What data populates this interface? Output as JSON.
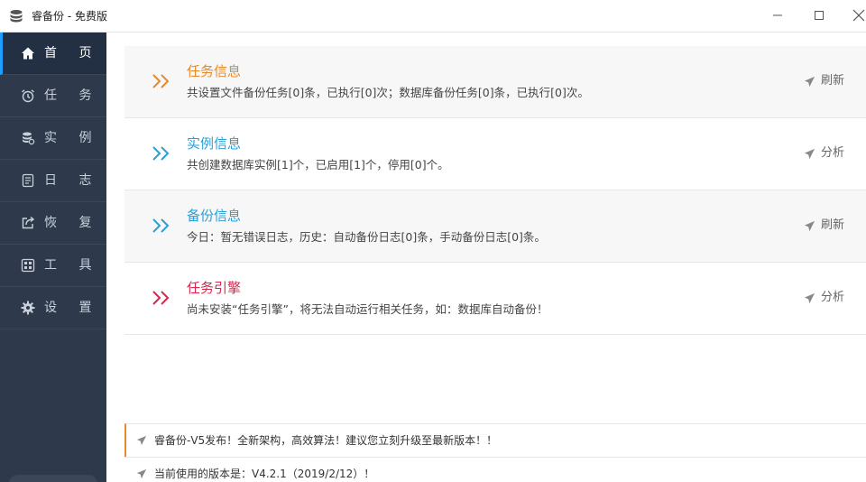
{
  "window": {
    "title": "睿备份 - 免费版",
    "controls": [
      "minimize",
      "maximize",
      "close"
    ]
  },
  "sidebar": {
    "items": [
      {
        "label": "首 页",
        "icon": "home-icon",
        "active": true
      },
      {
        "label": "任 务",
        "icon": "alarm-clock-icon",
        "active": false
      },
      {
        "label": "实 例",
        "icon": "database-icon",
        "active": false
      },
      {
        "label": "日 志",
        "icon": "log-document-icon",
        "active": false
      },
      {
        "label": "恢 复",
        "icon": "restore-share-icon",
        "active": false
      },
      {
        "label": "工 具",
        "icon": "tools-grid-icon",
        "active": false
      },
      {
        "label": "设 置",
        "icon": "gear-icon",
        "active": false
      }
    ]
  },
  "cards": [
    {
      "title": "任务信息",
      "desc": "共设置文件备份任务[0]条，已执行[0]次；数据库备份任务[0]条，已执行[0]次。",
      "action": "刷新",
      "color": "#e68a2e"
    },
    {
      "title": "实例信息",
      "desc": "共创建数据库实例[1]个，已启用[1]个，停用[0]个。",
      "action": "分析",
      "color": "#2a9fd6"
    },
    {
      "title": "备份信息",
      "desc": "今日：暂无错误日志，历史：自动备份日志[0]条，手动备份日志[0]条。",
      "action": "刷新",
      "color": "#2a9fd6"
    },
    {
      "title": "任务引擎",
      "desc": "尚未安装“任务引擎”，将无法自动运行相关任务，如：数据库自动备份！",
      "action": "分析",
      "color": "#d6284f"
    }
  ],
  "notices": [
    {
      "text": "睿备份-V5发布！全新架构，高效算法！建议您立刻升级至最新版本！！"
    },
    {
      "text": "当前使用的版本是：V4.2.1（2019/2/12）！"
    }
  ],
  "colors": {
    "sidebar_bg": "#2e3a4c",
    "sidebar_active": "#233044",
    "accent_blue": "#1e9fff",
    "orange": "#e68a2e",
    "blue": "#2a9fd6",
    "red": "#d6284f"
  }
}
